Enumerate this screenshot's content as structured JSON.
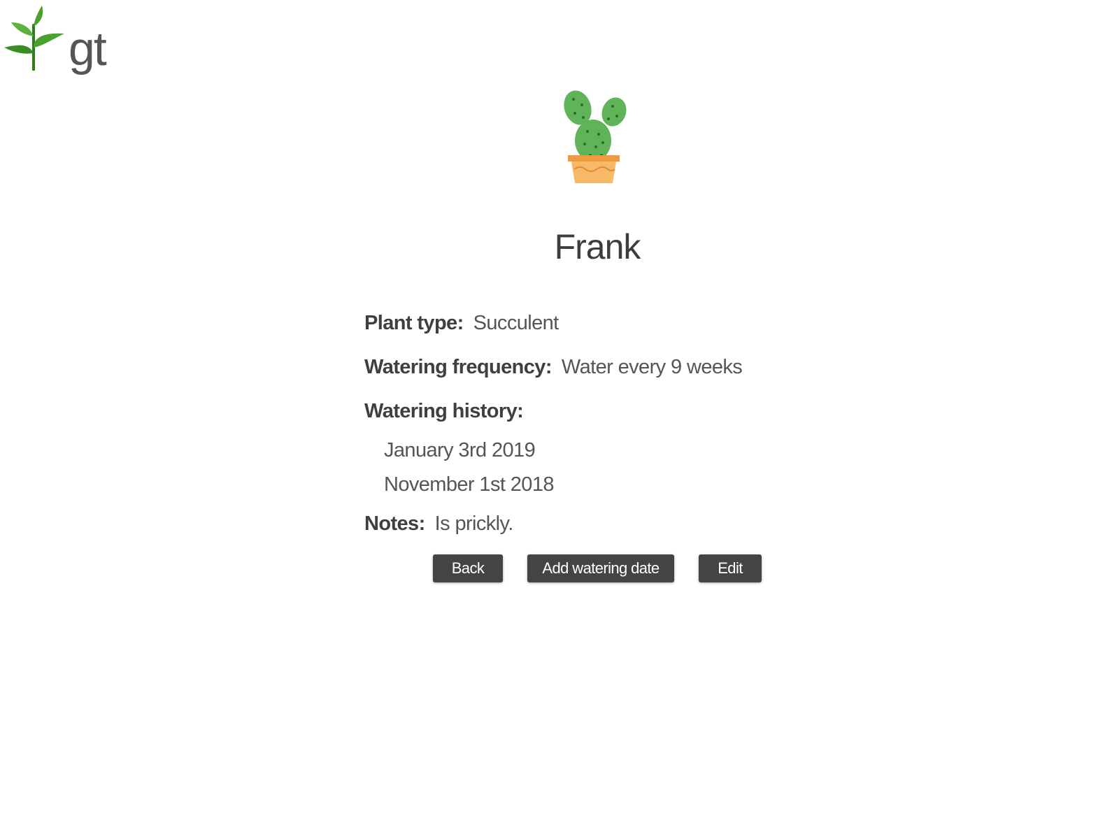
{
  "brand": {
    "logo_text": "gt",
    "logo_icon": "sprout-icon",
    "accent_green": "#3f9a2d"
  },
  "plant": {
    "image_icon": "cactus-in-pot-icon",
    "name": "Frank",
    "type_label": "Plant type:",
    "type_value": "Succulent",
    "frequency_label": "Watering frequency:",
    "frequency_value": "Water every 9 weeks",
    "history_label": "Watering history:",
    "history": [
      "January 3rd 2019",
      "November 1st 2018"
    ],
    "notes_label": "Notes:",
    "notes_value": "Is prickly."
  },
  "actions": {
    "back_label": "Back",
    "add_label": "Add watering date",
    "edit_label": "Edit",
    "button_color": "#444444"
  }
}
